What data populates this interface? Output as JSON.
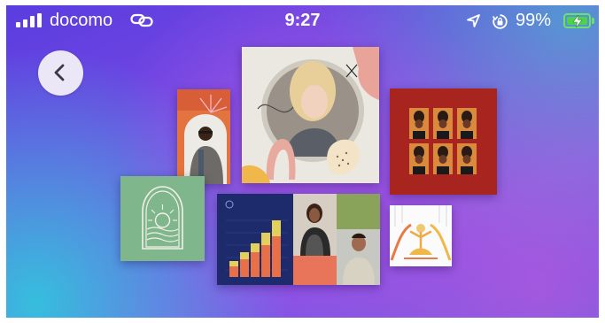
{
  "status_bar": {
    "carrier": "docomo",
    "time": "9:27",
    "battery_percent": "99%",
    "signal_bars": 4,
    "icons": [
      "signal-bars-icon",
      "link-icon",
      "location-arrow-icon",
      "rotation-lock-icon",
      "battery-charging-icon"
    ],
    "accent_battery": "#4ed14e"
  },
  "nav": {
    "back_icon": "chevron-left-icon"
  },
  "collage": {
    "cards": [
      "portrait-woman-card",
      "portrait-man-orange-card",
      "sun-arch-card",
      "photo-grid-red-card",
      "bar-chart-people-card",
      "illustration-small-card"
    ]
  },
  "colors": {
    "background_top": "#5a3de0",
    "background_teal": "#28d2dc",
    "red_card": "#a8231e",
    "green_card": "#7fb58a",
    "navy_card": "#1e2d6e"
  }
}
